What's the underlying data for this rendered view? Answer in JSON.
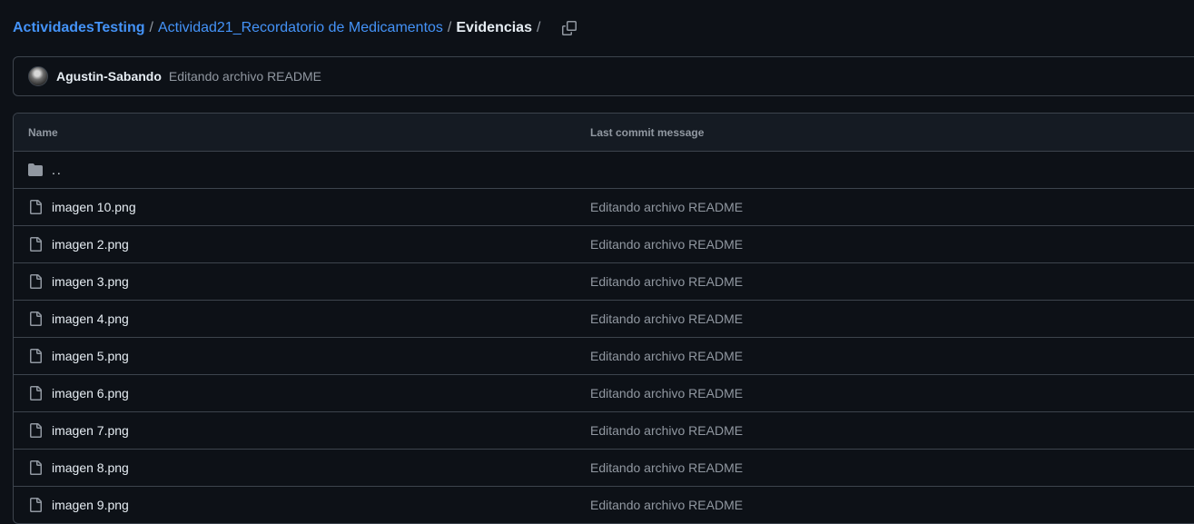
{
  "breadcrumb": {
    "root": "ActividadesTesting",
    "folder": "Actividad21_Recordatorio de Medicamentos",
    "current": "Evidencias",
    "separator": "/",
    "copy_icon": "copy-icon"
  },
  "commit": {
    "author": "Agustin-Sabando",
    "message": "Editando archivo README"
  },
  "table": {
    "headers": {
      "name": "Name",
      "last_commit_message": "Last commit message"
    },
    "parent_dir": "..",
    "files": [
      {
        "name": "imagen 10.png",
        "message": "Editando archivo README"
      },
      {
        "name": "imagen 2.png",
        "message": "Editando archivo README"
      },
      {
        "name": "imagen 3.png",
        "message": "Editando archivo README"
      },
      {
        "name": "imagen 4.png",
        "message": "Editando archivo README"
      },
      {
        "name": "imagen 5.png",
        "message": "Editando archivo README"
      },
      {
        "name": "imagen 6.png",
        "message": "Editando archivo README"
      },
      {
        "name": "imagen 7.png",
        "message": "Editando archivo README"
      },
      {
        "name": "imagen 8.png",
        "message": "Editando archivo README"
      },
      {
        "name": "imagen 9.png",
        "message": "Editando archivo README"
      }
    ]
  },
  "colors": {
    "background": "#0d1117",
    "link": "#4493f8",
    "border": "#3d444d",
    "muted": "#9198a1",
    "header_bg": "#151b23"
  }
}
